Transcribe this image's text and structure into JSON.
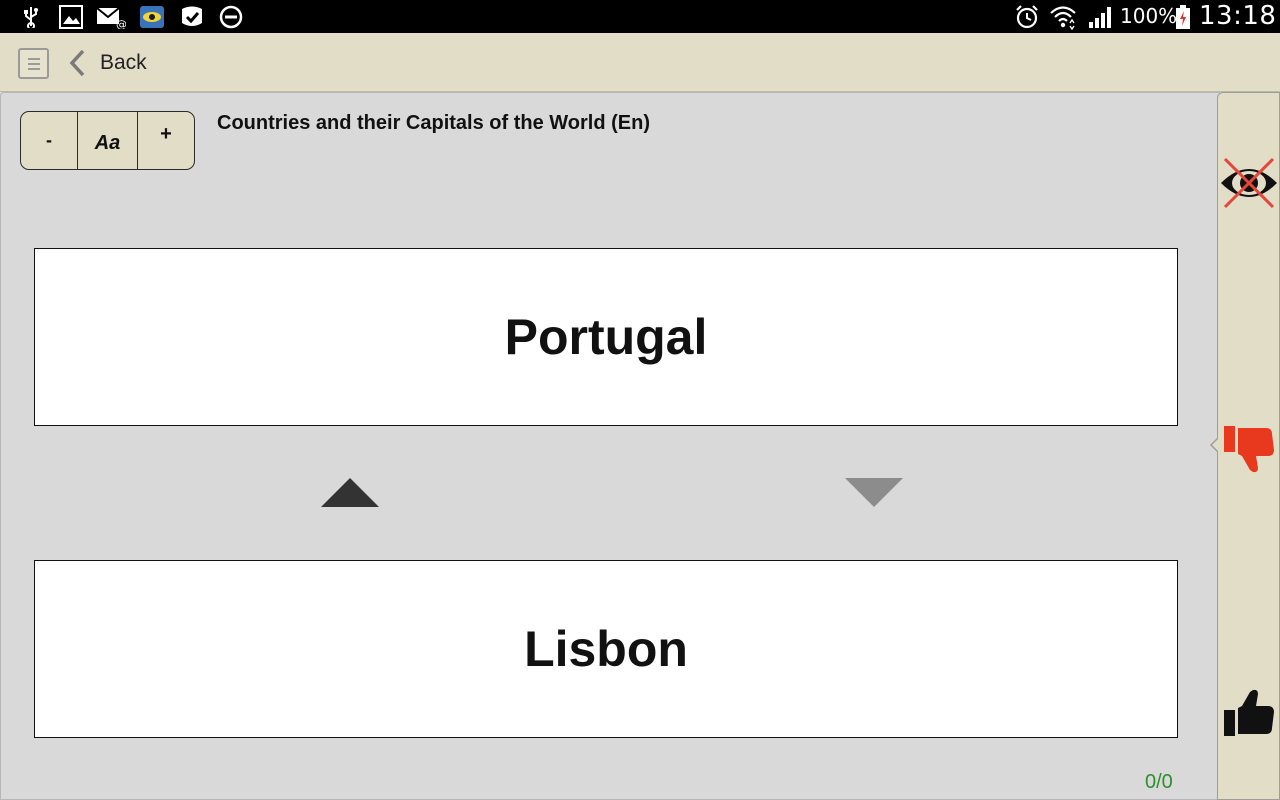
{
  "status_bar": {
    "left_icons": [
      "usb-icon",
      "gallery-icon",
      "email-icon",
      "app-eye-icon",
      "tasks-check-icon",
      "do-not-disturb-icon"
    ],
    "right_icons": [
      "alarm-icon",
      "wifi-icon",
      "signal-icon",
      "battery-charging-icon"
    ],
    "battery": "100%",
    "time": "13:18"
  },
  "action_bar": {
    "back_label": "Back"
  },
  "font_controls": {
    "decrease": "-",
    "font_label": "Aa",
    "increase": "+"
  },
  "deck": {
    "title": "Countries and their Capitals of the World (En)"
  },
  "cards": {
    "front": "Portugal",
    "back": "Lisbon"
  },
  "progress": "0/0",
  "side_panel": {
    "icons": [
      "hide-answer-icon",
      "thumbs-down-icon",
      "thumbs-up-icon"
    ]
  },
  "colors": {
    "status_bar": "#000000",
    "action_bar": "#e2ddc6",
    "content_bg": "#d9d9d9",
    "card_bg": "#ffffff",
    "progress_text": "#2f8f2f",
    "thumbs_down": "#e8391e",
    "hide_cross": "#e5463a"
  }
}
